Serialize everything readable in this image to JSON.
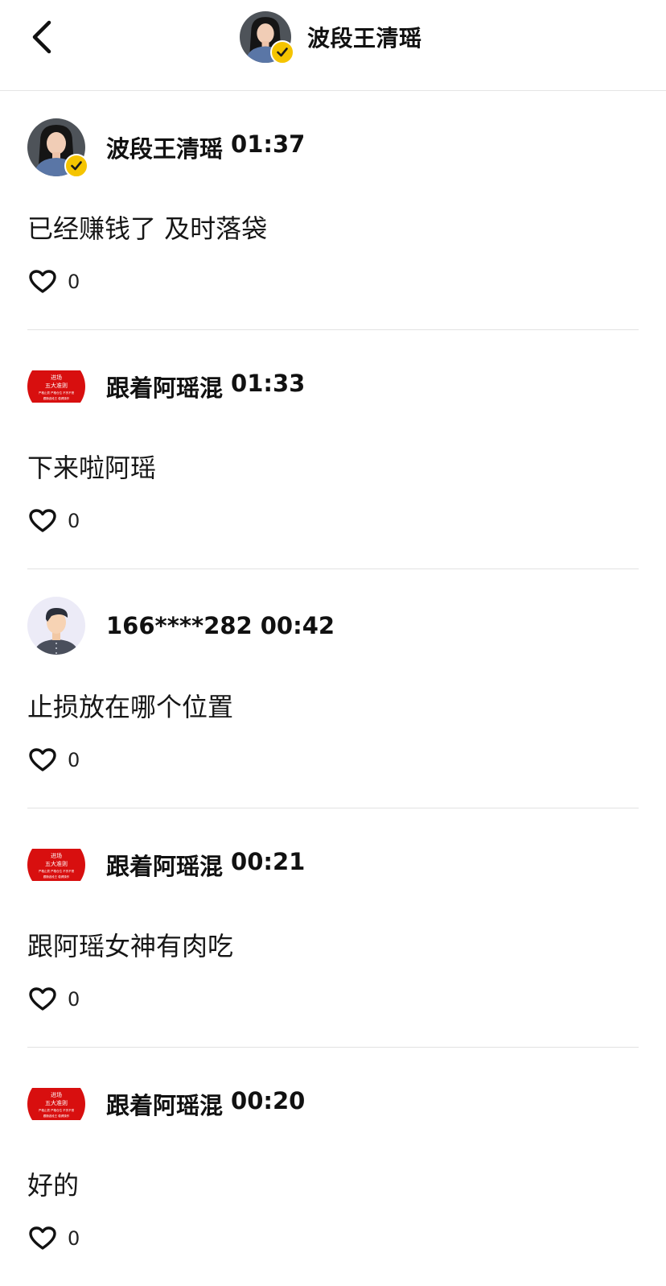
{
  "header": {
    "title": "波段王清瑶",
    "back_icon": "chevron-left-icon",
    "avatar_badge_icon": "verified-check-icon"
  },
  "comments": [
    {
      "username": "波段王清瑶",
      "time": "01:37",
      "text": "已经赚钱了 及时落袋",
      "likes": "0",
      "avatar": "photo-woman-verified"
    },
    {
      "username": "跟着阿瑶混",
      "time": "01:33",
      "text": "下来啦阿瑶",
      "likes": "0",
      "avatar": "red-banner"
    },
    {
      "username": "166****282",
      "time": "00:42",
      "text": "止损放在哪个位置",
      "likes": "0",
      "avatar": "default-man"
    },
    {
      "username": "跟着阿瑶混",
      "time": "00:21",
      "text": "跟阿瑶女神有肉吃",
      "likes": "0",
      "avatar": "red-banner"
    },
    {
      "username": "跟着阿瑶混",
      "time": "00:20",
      "text": "好的",
      "likes": "0",
      "avatar": "red-banner"
    }
  ],
  "avatar_banner_text": {
    "line1": "进场",
    "line2": "五大准则",
    "line3": "严格止损 严格仓位 不贪不慌",
    "line4": "跟随波段王 稳健操作"
  },
  "colors": {
    "accent_red": "#d80f0f",
    "badge_yellow": "#f5c400",
    "divider": "#e2e2e2"
  }
}
